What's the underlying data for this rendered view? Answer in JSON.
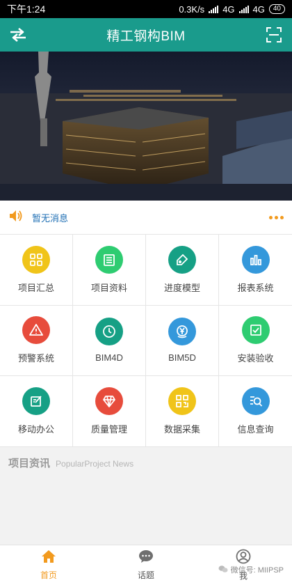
{
  "status_bar": {
    "time": "下午1:24",
    "speed": "0.3K/s",
    "net1": "4G",
    "net2": "4G",
    "battery": "40"
  },
  "app_bar": {
    "title": "精工钢构BIM",
    "left_icon": "switch-arrows-icon",
    "right_icon": "scan-icon"
  },
  "banner": {
    "description_icon": "city-night-photo"
  },
  "notice": {
    "icon": "speaker-icon",
    "text": "暂无消息",
    "more_icon": "more-dots-icon"
  },
  "grid": [
    {
      "label": "项目汇总",
      "color": "#f0c419",
      "icon": "grid-icon"
    },
    {
      "label": "项目资料",
      "color": "#2ecc71",
      "icon": "list-icon"
    },
    {
      "label": "进度模型",
      "color": "#16a085",
      "icon": "tag-icon"
    },
    {
      "label": "报表系统",
      "color": "#3498db",
      "icon": "bar-chart-icon"
    },
    {
      "label": "预警系统",
      "color": "#e74c3c",
      "icon": "warning-icon"
    },
    {
      "label": "BIM4D",
      "color": "#16a085",
      "icon": "clock-icon"
    },
    {
      "label": "BIM5D",
      "color": "#3498db",
      "icon": "yen-icon"
    },
    {
      "label": "安装验收",
      "color": "#2ecc71",
      "icon": "check-icon"
    },
    {
      "label": "移动办公",
      "color": "#16a085",
      "icon": "edit-icon"
    },
    {
      "label": "质量管理",
      "color": "#e74c3c",
      "icon": "diamond-icon"
    },
    {
      "label": "数据采集",
      "color": "#f0c419",
      "icon": "qr-icon"
    },
    {
      "label": "信息查询",
      "color": "#3498db",
      "icon": "search-list-icon"
    }
  ],
  "news": {
    "title_cn": "项目资讯",
    "title_en": "PopularProject News"
  },
  "tabs": [
    {
      "label": "首页",
      "icon": "home-icon",
      "active": true
    },
    {
      "label": "话题",
      "icon": "chat-icon",
      "active": false
    },
    {
      "label": "我",
      "icon": "user-icon",
      "active": false
    }
  ],
  "watermark": {
    "text": "微信号: MIIPSP"
  }
}
